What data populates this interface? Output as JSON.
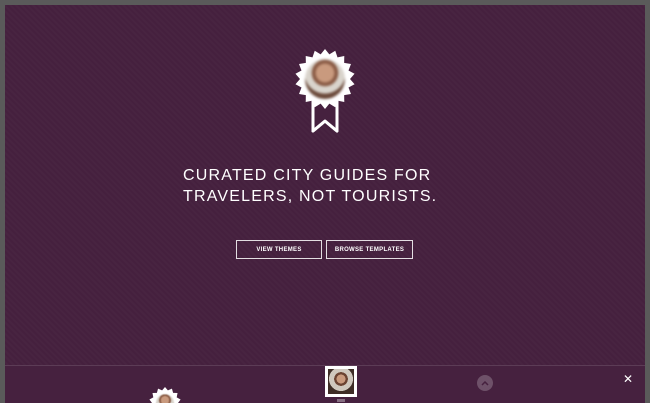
{
  "hero": {
    "tagline_line1": "CURATED CITY GUIDES FOR",
    "tagline_line2": "TRAVELERS, NOT TOURISTS.",
    "badge_icon": "ribbon-badge-icon"
  },
  "buttons": {
    "view_themes": "VIEW THEMES",
    "browse_templates": "BROWSE TEMPLATES"
  },
  "bottom_bar": {
    "close_symbol": "✕",
    "scroll_icon": "chevron-up-icon"
  },
  "colors": {
    "background": "#46213f",
    "frame": "#5a5a5a",
    "text": "#ffffff"
  }
}
